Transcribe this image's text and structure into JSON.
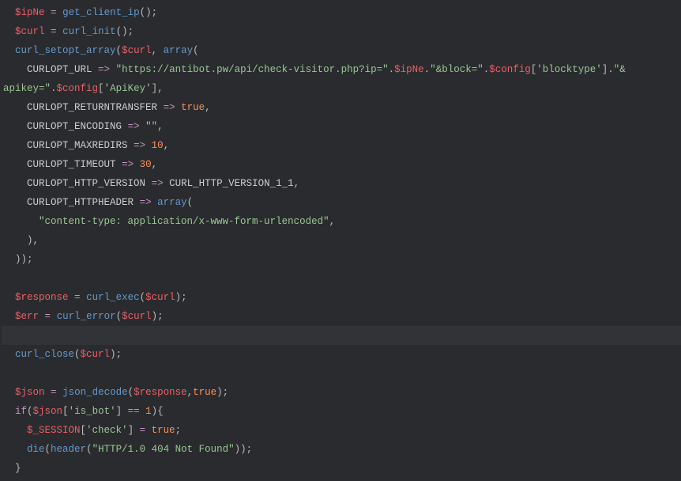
{
  "code": {
    "lines": [
      {
        "indent": 2,
        "tokens": [
          [
            "var",
            "$ipNe"
          ],
          [
            "punc",
            " "
          ],
          [
            "op",
            "="
          ],
          [
            "punc",
            " "
          ],
          [
            "fn",
            "get_client_ip"
          ],
          [
            "punc",
            "();"
          ]
        ]
      },
      {
        "indent": 2,
        "tokens": [
          [
            "var",
            "$curl"
          ],
          [
            "punc",
            " "
          ],
          [
            "op",
            "="
          ],
          [
            "punc",
            " "
          ],
          [
            "fn",
            "curl_init"
          ],
          [
            "punc",
            "();"
          ]
        ]
      },
      {
        "indent": 2,
        "tokens": [
          [
            "fn",
            "curl_setopt_array"
          ],
          [
            "punc",
            "("
          ],
          [
            "var",
            "$curl"
          ],
          [
            "punc",
            ", "
          ],
          [
            "arrfn",
            "array"
          ],
          [
            "punc",
            "("
          ]
        ]
      },
      {
        "indent": 4,
        "tokens": [
          [
            "const",
            "CURLOPT_URL"
          ],
          [
            "punc",
            " "
          ],
          [
            "op",
            "=>"
          ],
          [
            "punc",
            " "
          ],
          [
            "str",
            "\"https://antibot.pw/api/check-visitor.php?ip=\""
          ],
          [
            "punc",
            "."
          ],
          [
            "var",
            "$ipNe"
          ],
          [
            "punc",
            "."
          ],
          [
            "str",
            "\"&block=\""
          ],
          [
            "punc",
            "."
          ],
          [
            "var",
            "$config"
          ],
          [
            "punc",
            "["
          ],
          [
            "str",
            "'blocktype'"
          ],
          [
            "punc",
            "]"
          ],
          [
            "punc",
            "."
          ],
          [
            "str",
            "\"&apikey=\""
          ],
          [
            "punc",
            "."
          ],
          [
            "var",
            "$config"
          ],
          [
            "punc",
            "["
          ],
          [
            "str",
            "'ApiKey'"
          ],
          [
            "punc",
            "],"
          ]
        ],
        "wrap": true
      },
      {
        "indent": 4,
        "tokens": [
          [
            "const",
            "CURLOPT_RETURNTRANSFER"
          ],
          [
            "punc",
            " "
          ],
          [
            "op",
            "=>"
          ],
          [
            "punc",
            " "
          ],
          [
            "bool",
            "true"
          ],
          [
            "punc",
            ","
          ]
        ]
      },
      {
        "indent": 4,
        "tokens": [
          [
            "const",
            "CURLOPT_ENCODING"
          ],
          [
            "punc",
            " "
          ],
          [
            "op",
            "=>"
          ],
          [
            "punc",
            " "
          ],
          [
            "str",
            "\"\""
          ],
          [
            "punc",
            ","
          ]
        ]
      },
      {
        "indent": 4,
        "tokens": [
          [
            "const",
            "CURLOPT_MAXREDIRS"
          ],
          [
            "punc",
            " "
          ],
          [
            "op",
            "=>"
          ],
          [
            "punc",
            " "
          ],
          [
            "num",
            "10"
          ],
          [
            "punc",
            ","
          ]
        ]
      },
      {
        "indent": 4,
        "tokens": [
          [
            "const",
            "CURLOPT_TIMEOUT"
          ],
          [
            "punc",
            " "
          ],
          [
            "op",
            "=>"
          ],
          [
            "punc",
            " "
          ],
          [
            "num",
            "30"
          ],
          [
            "punc",
            ","
          ]
        ]
      },
      {
        "indent": 4,
        "tokens": [
          [
            "const",
            "CURLOPT_HTTP_VERSION"
          ],
          [
            "punc",
            " "
          ],
          [
            "op",
            "=>"
          ],
          [
            "punc",
            " "
          ],
          [
            "const",
            "CURL_HTTP_VERSION_1_1"
          ],
          [
            "punc",
            ","
          ]
        ]
      },
      {
        "indent": 4,
        "tokens": [
          [
            "const",
            "CURLOPT_HTTPHEADER"
          ],
          [
            "punc",
            " "
          ],
          [
            "op",
            "=>"
          ],
          [
            "punc",
            " "
          ],
          [
            "arrfn",
            "array"
          ],
          [
            "punc",
            "("
          ]
        ]
      },
      {
        "indent": 6,
        "tokens": [
          [
            "str",
            "\"content-type: application/x-www-form-urlencoded\""
          ],
          [
            "punc",
            ","
          ]
        ]
      },
      {
        "indent": 4,
        "tokens": [
          [
            "punc",
            "),"
          ]
        ]
      },
      {
        "indent": 2,
        "tokens": [
          [
            "punc",
            "));"
          ]
        ]
      },
      {
        "indent": 0,
        "tokens": []
      },
      {
        "indent": 2,
        "tokens": [
          [
            "var",
            "$response"
          ],
          [
            "punc",
            " "
          ],
          [
            "op",
            "="
          ],
          [
            "punc",
            " "
          ],
          [
            "fn",
            "curl_exec"
          ],
          [
            "punc",
            "("
          ],
          [
            "var",
            "$curl"
          ],
          [
            "punc",
            ");"
          ]
        ]
      },
      {
        "indent": 2,
        "tokens": [
          [
            "var",
            "$err"
          ],
          [
            "punc",
            " "
          ],
          [
            "op",
            "="
          ],
          [
            "punc",
            " "
          ],
          [
            "fn",
            "curl_error"
          ],
          [
            "punc",
            "("
          ],
          [
            "var",
            "$curl"
          ],
          [
            "punc",
            ");"
          ]
        ]
      },
      {
        "indent": 0,
        "tokens": [],
        "highlight": true
      },
      {
        "indent": 2,
        "tokens": [
          [
            "fn",
            "curl_close"
          ],
          [
            "punc",
            "("
          ],
          [
            "var",
            "$curl"
          ],
          [
            "punc",
            ");"
          ]
        ]
      },
      {
        "indent": 0,
        "tokens": []
      },
      {
        "indent": 2,
        "tokens": [
          [
            "var",
            "$json"
          ],
          [
            "punc",
            " "
          ],
          [
            "op",
            "="
          ],
          [
            "punc",
            " "
          ],
          [
            "fn",
            "json_decode"
          ],
          [
            "punc",
            "("
          ],
          [
            "var",
            "$response"
          ],
          [
            "punc",
            ","
          ],
          [
            "bool",
            "true"
          ],
          [
            "punc",
            ");"
          ]
        ]
      },
      {
        "indent": 2,
        "tokens": [
          [
            "op",
            "if"
          ],
          [
            "punc",
            "("
          ],
          [
            "var",
            "$json"
          ],
          [
            "punc",
            "["
          ],
          [
            "str",
            "'is_bot'"
          ],
          [
            "punc",
            "] "
          ],
          [
            "op",
            "=="
          ],
          [
            "punc",
            " "
          ],
          [
            "num",
            "1"
          ],
          [
            "punc",
            "){"
          ]
        ]
      },
      {
        "indent": 4,
        "tokens": [
          [
            "var",
            "$_SESSION"
          ],
          [
            "punc",
            "["
          ],
          [
            "str",
            "'check'"
          ],
          [
            "punc",
            "] "
          ],
          [
            "op",
            "="
          ],
          [
            "punc",
            " "
          ],
          [
            "bool",
            "true"
          ],
          [
            "punc",
            ";"
          ]
        ]
      },
      {
        "indent": 4,
        "tokens": [
          [
            "fn",
            "die"
          ],
          [
            "punc",
            "("
          ],
          [
            "fn",
            "header"
          ],
          [
            "punc",
            "("
          ],
          [
            "str",
            "\"HTTP/1.0 404 Not Found\""
          ],
          [
            "punc",
            "));"
          ]
        ]
      },
      {
        "indent": 2,
        "tokens": [
          [
            "punc",
            "}"
          ]
        ]
      }
    ]
  }
}
